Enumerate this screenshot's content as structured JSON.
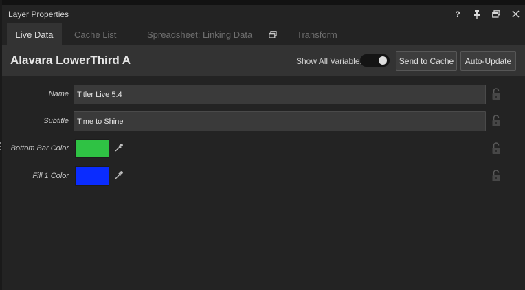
{
  "window": {
    "title": "Layer Properties",
    "controls": [
      {
        "name": "help-button",
        "glyph": "?"
      },
      {
        "name": "pin-button",
        "glyph": "pin"
      },
      {
        "name": "restore-button",
        "glyph": "restore"
      },
      {
        "name": "close-button",
        "glyph": "close"
      }
    ]
  },
  "tabs": [
    {
      "label": "Live Data",
      "active": true
    },
    {
      "label": "Cache List",
      "active": false
    },
    {
      "label": "Spreadsheet: Linking Data",
      "active": false
    },
    {
      "label": "Transform",
      "active": false
    }
  ],
  "header": {
    "layer_name": "Alavara LowerThird A",
    "show_all_label": "Show All Variables",
    "show_all_on": true,
    "send_to_cache_label": "Send to Cache",
    "auto_update_label": "Auto-Update"
  },
  "fields": {
    "name": {
      "label": "Name",
      "value": "Titler Live 5.4"
    },
    "subtitle": {
      "label": "Subtitle",
      "value": "Time to Shine"
    },
    "bottom_bar_color": {
      "label": "Bottom Bar Color",
      "color": "#2fc244"
    },
    "fill_color": {
      "label": "Fill 1 Color",
      "color": "#0a2cff"
    }
  },
  "icons": {
    "help": "question-icon",
    "pin": "pin-icon",
    "restore": "window-restore-icon",
    "close": "close-icon",
    "float": "window-float-icon",
    "eyedropper": "eyedropper-icon",
    "lock": "lock-open-icon"
  }
}
